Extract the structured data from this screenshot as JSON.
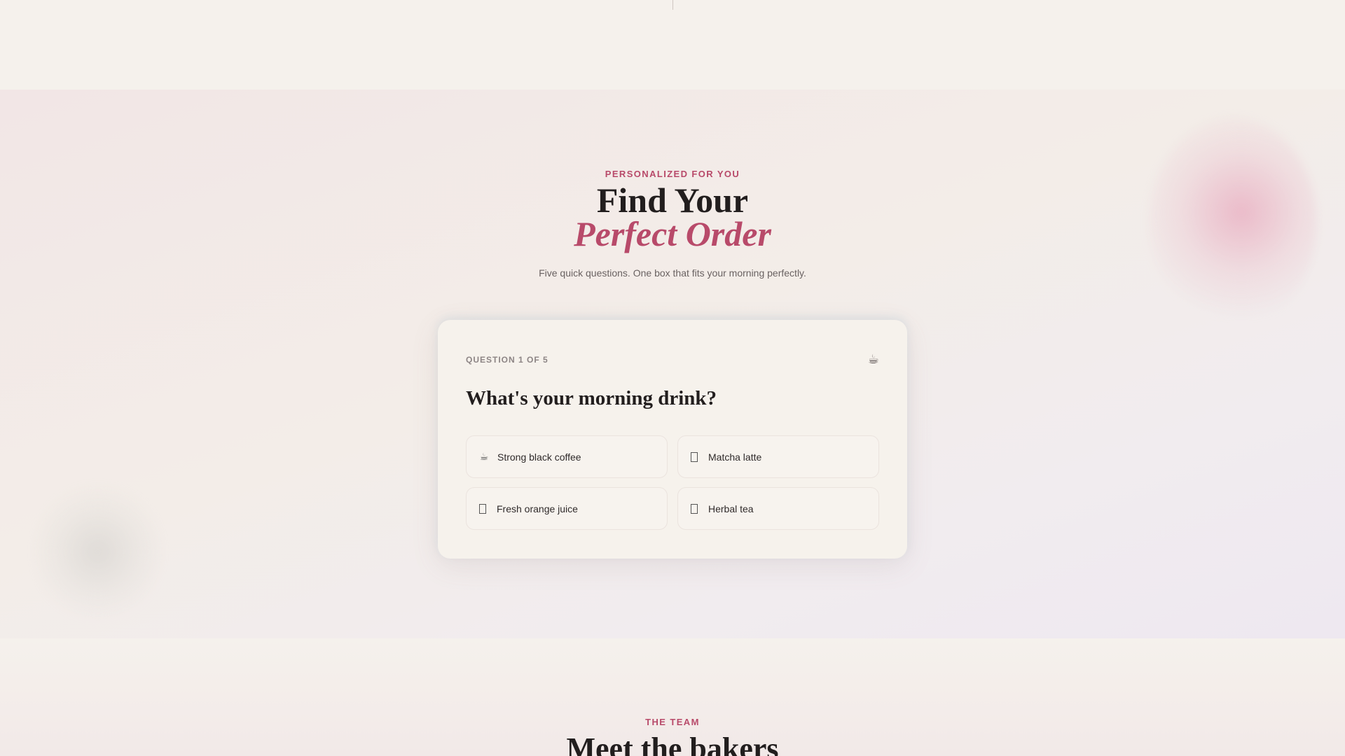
{
  "quiz": {
    "eyebrow": "PERSONALIZED FOR YOU",
    "headline_line1": "Find Your",
    "headline_line2": "Perfect Order",
    "subline": "Five quick questions. One box that fits your morning perfectly.",
    "card": {
      "counter": "QUESTION 1 OF 5",
      "icon": "coffee-cup-icon",
      "icon_glyph": "☕",
      "question": "What's your morning drink?",
      "options": [
        {
          "label": "Strong black coffee",
          "icon": "coffee-cup-icon",
          "glyph": "☕"
        },
        {
          "label": "Matcha latte",
          "icon": "missing-glyph-icon",
          "glyph": ""
        },
        {
          "label": "Fresh orange juice",
          "icon": "missing-glyph-icon",
          "glyph": ""
        },
        {
          "label": "Herbal tea",
          "icon": "missing-glyph-icon",
          "glyph": ""
        }
      ]
    }
  },
  "team": {
    "eyebrow": "THE TEAM",
    "title": "Meet the bakers"
  },
  "colors": {
    "accent": "#b84a6a",
    "background": "#f5f1ec",
    "card": "#f6f2ec",
    "text": "#221e1e"
  }
}
